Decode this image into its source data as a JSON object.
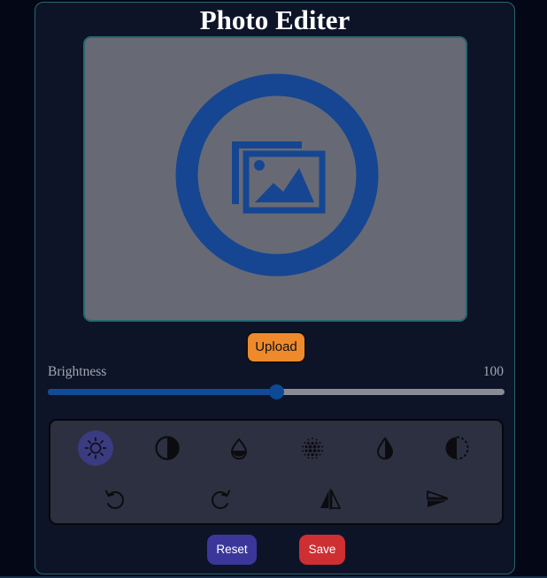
{
  "app": {
    "title": "Photo Editer"
  },
  "preview": {
    "icon": "photo-placeholder-icon",
    "icon_color": "#164692"
  },
  "upload": {
    "label": "Upload"
  },
  "slider": {
    "label": "Brightness",
    "value": "100",
    "fraction": 0.5
  },
  "tools": [
    {
      "icon": "brightness-icon",
      "active": true
    },
    {
      "icon": "contrast-icon",
      "active": false
    },
    {
      "icon": "saturation-icon",
      "active": false
    },
    {
      "icon": "blur-icon",
      "active": false
    },
    {
      "icon": "hue-drop-icon",
      "active": false
    },
    {
      "icon": "invert-icon",
      "active": false
    },
    {
      "icon": "rotate-left-icon",
      "active": false
    },
    {
      "icon": "rotate-right-icon",
      "active": false
    },
    {
      "icon": "flip-horizontal-icon",
      "active": false
    },
    {
      "icon": "flip-vertical-icon",
      "active": false
    }
  ],
  "actions": {
    "reset_label": "Reset",
    "save_label": "Save"
  },
  "colors": {
    "upload": "#ee8a2c",
    "reset": "#3b379a",
    "save": "#cd2f33",
    "accent": "#114b95",
    "active_tool": "#3a3b80"
  }
}
